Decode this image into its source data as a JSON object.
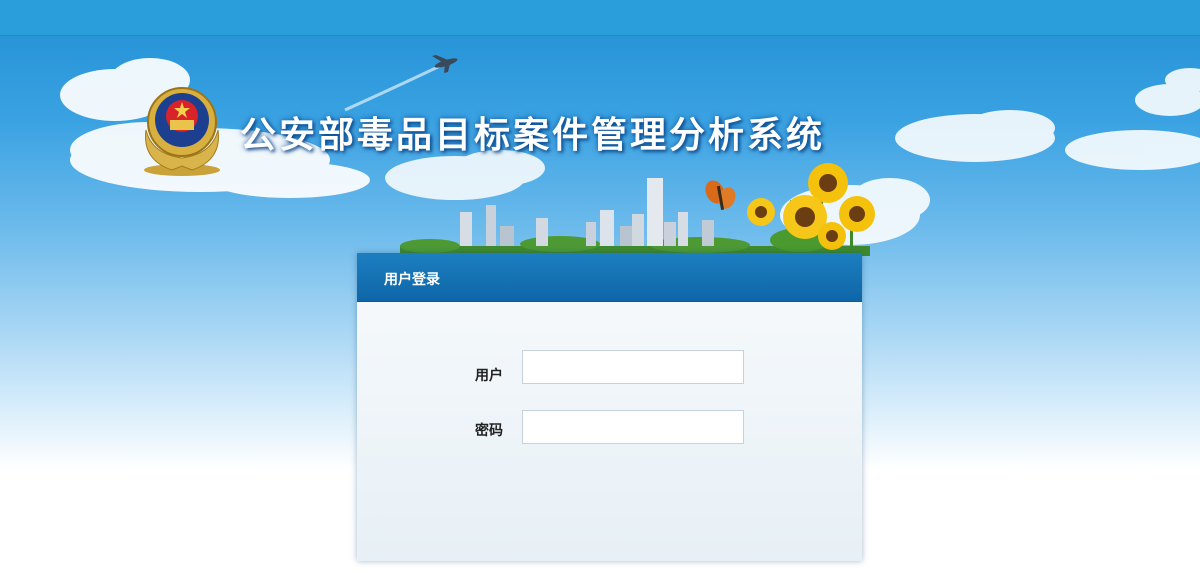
{
  "header": {
    "system_title": "公安部毒品目标案件管理分析系统",
    "emblem_icon": "police-emblem-icon"
  },
  "login": {
    "panel_title": "用户登录",
    "username_label": "用户",
    "username_value": "",
    "password_label": "密码",
    "password_value": ""
  },
  "colors": {
    "sky_top": "#1f8fd4",
    "panel_header": "#0e66a8",
    "panel_body": "#eef4f8"
  }
}
